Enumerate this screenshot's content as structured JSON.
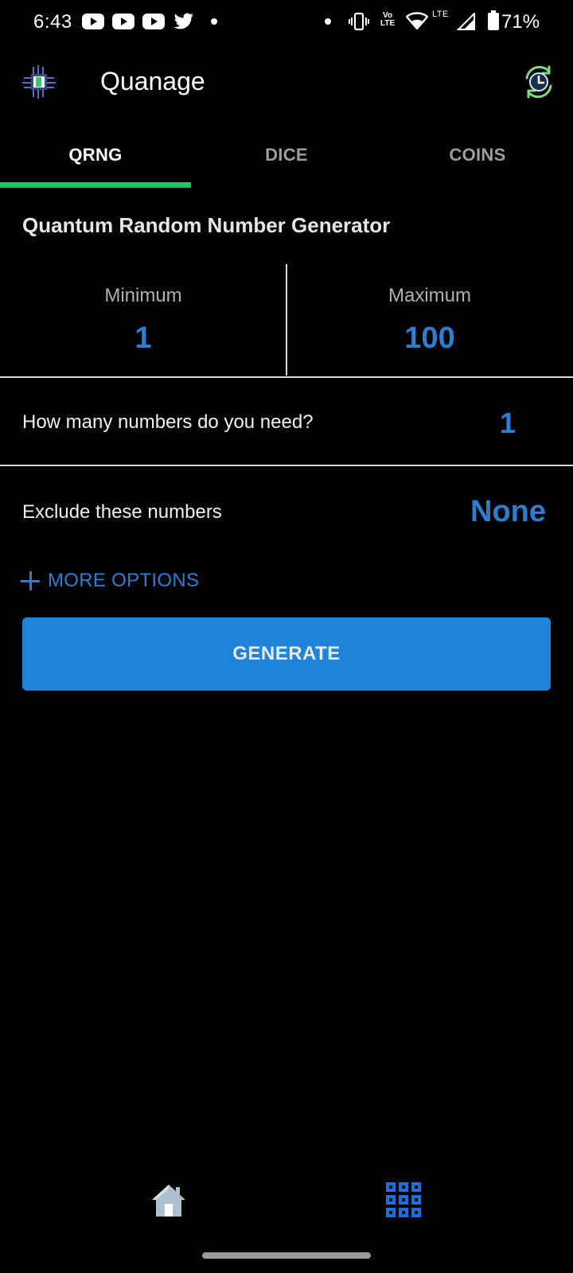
{
  "status_bar": {
    "time": "6:43",
    "volte_top": "Vo",
    "volte_bottom": "LTE",
    "lte_label": "LTE",
    "battery": "71%"
  },
  "app_bar": {
    "title": "Quanage"
  },
  "tabs": [
    {
      "label": "QRNG",
      "active": true
    },
    {
      "label": "DICE",
      "active": false
    },
    {
      "label": "COINS",
      "active": false
    }
  ],
  "qrng": {
    "title": "Quantum Random Number Generator",
    "minimum": {
      "label": "Minimum",
      "value": "1"
    },
    "maximum": {
      "label": "Maximum",
      "value": "100"
    },
    "count": {
      "label": "How many numbers do you need?",
      "value": "1"
    },
    "exclude": {
      "label": "Exclude these numbers",
      "value": "None"
    },
    "more_options": "MORE OPTIONS",
    "generate": "GENERATE"
  },
  "bottom_nav": [
    {
      "icon": "home-icon"
    },
    {
      "icon": "grid-icon"
    }
  ],
  "colors": {
    "accent": "#2a7fd4",
    "button": "#1f84d9",
    "tab_indicator": "#22c55e",
    "background": "#000000"
  }
}
